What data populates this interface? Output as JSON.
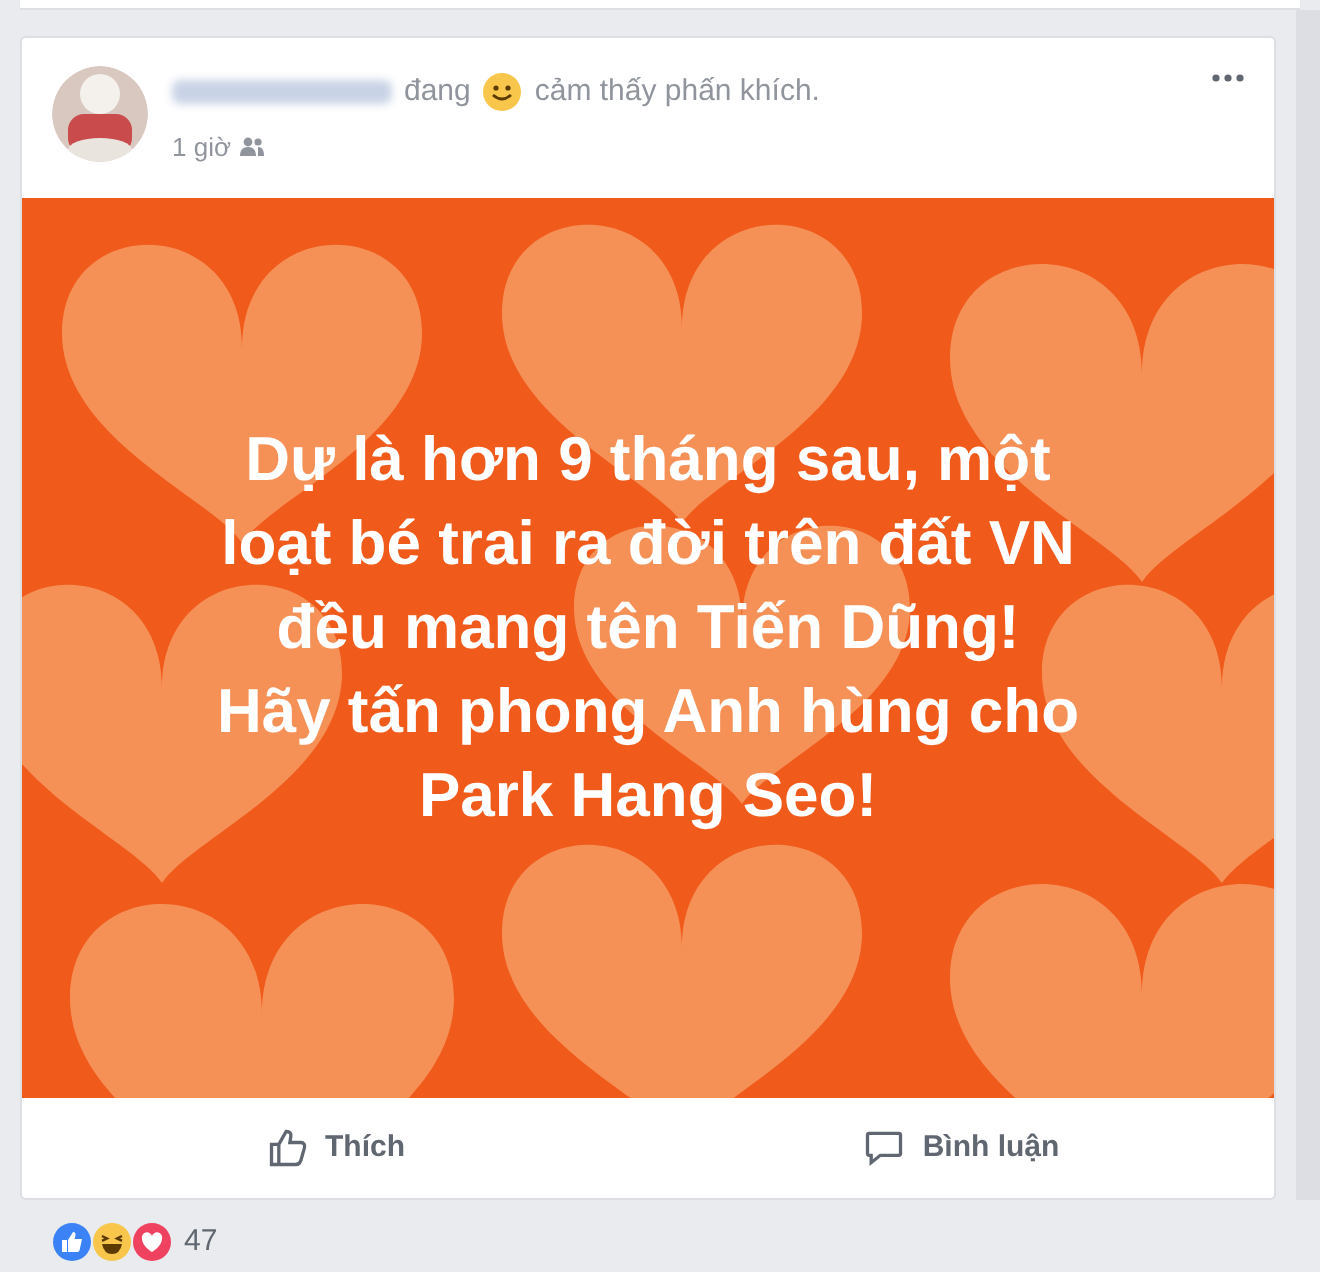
{
  "post": {
    "feeling_verb": "đang",
    "feeling": "cảm thấy phấn khích.",
    "time": "1 giờ"
  },
  "status_lines": [
    "Dự là hơn 9 tháng sau, một",
    "loạt bé trai ra đời trên đất VN",
    "đều mang tên Tiến Dũng!",
    "Hãy tấn phong Anh hùng cho",
    "Park Hang Seo!"
  ],
  "actions": [
    {
      "kind": "like",
      "label": "Thích"
    },
    {
      "kind": "comment",
      "label": "Bình luận"
    }
  ],
  "reactions": {
    "count": "47"
  }
}
